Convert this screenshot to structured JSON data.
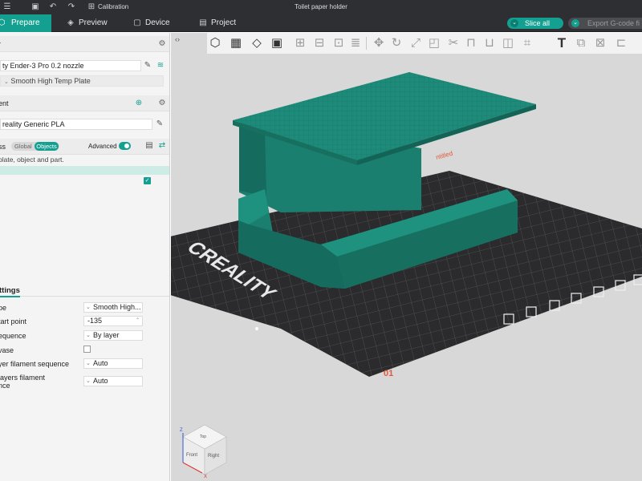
{
  "titlebar": {
    "window_title": "Toilet paper holder",
    "calibration_label": "Calibration",
    "icons": [
      "save-icon",
      "undo-icon",
      "redo-icon",
      "calibration-icon"
    ]
  },
  "tabs": [
    {
      "label": "Prepare",
      "icon": "cube-icon",
      "active": true
    },
    {
      "label": "Preview",
      "icon": "layers-icon",
      "active": false
    },
    {
      "label": "Device",
      "icon": "device-icon",
      "active": false
    },
    {
      "label": "Project",
      "icon": "project-icon",
      "active": false
    }
  ],
  "actions": {
    "slice_all": "Slice all",
    "export_gcode": "Export G-code fi"
  },
  "printer": {
    "section_label": "r",
    "name": "ty Ender-3 Pro 0.2 nozzle",
    "plate": "Smooth High Temp Plate"
  },
  "filament": {
    "section_label": "ent",
    "name": "reality Generic PLA"
  },
  "process": {
    "section_label": "ss",
    "global_label": "Global",
    "objects_label": "Objects",
    "advanced_label": "Advanced",
    "hint": "plate, object and part."
  },
  "settings": {
    "tab_label": "ttings",
    "rows": [
      {
        "label": "pe",
        "value": "Smooth High..."
      },
      {
        "label": "tart point",
        "value": "-135"
      },
      {
        "label": "equence",
        "value": "By layer"
      },
      {
        "label": "vase",
        "value": ""
      },
      {
        "label": "yer filament sequence",
        "value": "Auto"
      },
      {
        "label": "layers filament",
        "label2": "nce",
        "value": "Auto"
      }
    ]
  },
  "viewport": {
    "bed_logo": "CREALITY",
    "plate_number": "01",
    "plate_label": "ntitled",
    "cube_labels": {
      "top": "Top",
      "front": "Front",
      "right": "Right",
      "z": "Z",
      "x": "X"
    },
    "model_color": "#1b7f70",
    "accent_color": "#14a091"
  }
}
